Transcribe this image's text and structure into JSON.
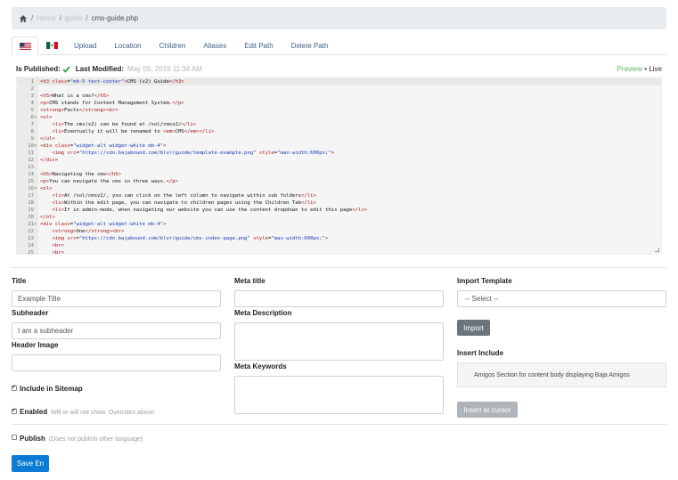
{
  "breadcrumb": {
    "home_icon": "home-icon",
    "items": [
      "Home",
      "guide"
    ],
    "current": "cms-guide.php"
  },
  "tabs": {
    "flags": [
      {
        "icon": "us-flag-icon"
      },
      {
        "icon": "mx-flag-icon"
      }
    ],
    "items": [
      "Upload",
      "Location",
      "Children",
      "Aliases",
      "Edit Path",
      "Delete Path"
    ]
  },
  "status": {
    "published_label": "Is Published:",
    "modified_label": "Last Modified:",
    "modified_value": "May 09, 2019 11:34 AM",
    "preview": "Preview",
    "bullet": "•",
    "live": "Live"
  },
  "editor": {
    "lines": [
      {
        "n": "1",
        "fold": false,
        "html": "<span class=\"tag\">&lt;h3</span> <span class=\"attr\">class</span>=<span class=\"val\">\"mb-5 text-center\"</span><span class=\"tag\">&gt;</span>CMS (v2) Guide<span class=\"tag\">&lt;/h3&gt;</span>"
      },
      {
        "n": "2",
        "fold": false,
        "html": ""
      },
      {
        "n": "3",
        "fold": false,
        "html": "<span class=\"tag\">&lt;h5&gt;</span>What is a cms?<span class=\"tag\">&lt;/h5&gt;</span>"
      },
      {
        "n": "4",
        "fold": false,
        "html": "<span class=\"tag\">&lt;p&gt;</span>CMS stands for Content Management System.<span class=\"tag\">&lt;/p&gt;</span>"
      },
      {
        "n": "5",
        "fold": false,
        "html": "<span class=\"tag\">&lt;strong&gt;</span>Facts<span class=\"tag\">&lt;/strong&gt;&lt;br&gt;</span>"
      },
      {
        "n": "6",
        "fold": true,
        "html": "<span class=\"tag\">&lt;ul&gt;</span>"
      },
      {
        "n": "7",
        "fold": false,
        "html": "    <span class=\"tag\">&lt;li&gt;</span>The cms(v2) can be found at /sol/cmsv2/<span class=\"tag\">&lt;/li&gt;</span>"
      },
      {
        "n": "8",
        "fold": false,
        "html": "    <span class=\"tag\">&lt;li&gt;</span>Eventually it will be renamed to <span class=\"tag\">&lt;em&gt;</span>CMS<span class=\"tag\">&lt;/em&gt;&lt;/li&gt;</span>"
      },
      {
        "n": "9",
        "fold": false,
        "html": "<span class=\"tag\">&lt;/ul&gt;</span>"
      },
      {
        "n": "10",
        "fold": true,
        "html": "<span class=\"tag\">&lt;div</span> <span class=\"attr\">class</span>=<span class=\"val\">\"widget-alt widget-white mb-4\"</span><span class=\"tag\">&gt;</span>"
      },
      {
        "n": "11",
        "fold": false,
        "html": "    <span class=\"tag\">&lt;img</span> <span class=\"attr\">src</span>=<span class=\"val\">\"https://cdn.bajabound.com/blvr/guide/template-example.png\"</span> <span class=\"attr\">style</span>=<span class=\"val\">\"max-width:600px;\"</span><span class=\"tag\">&gt;</span>"
      },
      {
        "n": "12",
        "fold": false,
        "html": "<span class=\"tag\">&lt;/div&gt;</span>"
      },
      {
        "n": "13",
        "fold": false,
        "html": ""
      },
      {
        "n": "14",
        "fold": false,
        "html": "<span class=\"tag\">&lt;h5&gt;</span>Navigating the cms<span class=\"tag\">&lt;/h5&gt;</span>"
      },
      {
        "n": "15",
        "fold": false,
        "html": "<span class=\"tag\">&lt;p&gt;</span>You can navigate the cms in three ways.<span class=\"tag\">&lt;/p&gt;</span>"
      },
      {
        "n": "16",
        "fold": true,
        "html": "<span class=\"tag\">&lt;ol&gt;</span>"
      },
      {
        "n": "17",
        "fold": false,
        "html": "    <span class=\"tag\">&lt;li&gt;</span>At /sol/cmsv2/, you can click on the left column to navigate within sub folders<span class=\"tag\">&lt;/li&gt;</span>"
      },
      {
        "n": "18",
        "fold": false,
        "html": "    <span class=\"tag\">&lt;li&gt;</span>Within the edit page, you can navigate to children pages using the Children Tab<span class=\"tag\">&lt;/li&gt;</span>"
      },
      {
        "n": "19",
        "fold": false,
        "html": "    <span class=\"tag\">&lt;li&gt;</span>If in admin-mode, when navigating our website you can use the content dropdown to edit this page<span class=\"tag\">&lt;/li&gt;</span>"
      },
      {
        "n": "20",
        "fold": false,
        "html": "<span class=\"tag\">&lt;/ol&gt;</span>"
      },
      {
        "n": "21",
        "fold": true,
        "html": "<span class=\"tag\">&lt;div</span> <span class=\"attr\">class</span>=<span class=\"val\">\"widget-alt widget-white mb-4\"</span><span class=\"tag\">&gt;</span>"
      },
      {
        "n": "22",
        "fold": false,
        "html": "    <span class=\"tag\">&lt;strong&gt;</span>One<span class=\"tag\">&lt;/strong&gt;&lt;br&gt;</span>"
      },
      {
        "n": "23",
        "fold": false,
        "html": "    <span class=\"tag\">&lt;img</span> <span class=\"attr\">src</span>=<span class=\"val\">\"https://cdn.bajabound.com/blvr/guide/cms-index-page.png\"</span> <span class=\"attr\">style</span>=<span class=\"val\">\"max-width:600px;\"</span><span class=\"tag\">&gt;</span>"
      },
      {
        "n": "24",
        "fold": false,
        "html": "    <span class=\"tag\">&lt;br&gt;</span>"
      },
      {
        "n": "25",
        "fold": false,
        "html": "    <span class=\"tag\">&lt;br&gt;</span>"
      }
    ]
  },
  "form": {
    "title_label": "Title",
    "title_placeholder": "Example Title",
    "subheader_label": "Subheader",
    "subheader_placeholder": "I am a subheader",
    "header_image_label": "Header Image",
    "meta_title_label": "Meta title",
    "meta_description_label": "Meta Description",
    "meta_keywords_label": "Meta Keywords",
    "import_template_label": "Import Template",
    "import_select_value": "-- Select --",
    "import_button": "Import",
    "insert_include_label": "Insert Include",
    "insert_include_text": "Amigos Section for content body displaying Baja Amigos",
    "insert_button": "Insert at cursor",
    "sitemap_label": "Include in Sitemap",
    "sitemap_checked": true,
    "enabled_label": "Enabled",
    "enabled_hint": "Will or will not show. Overrides above.",
    "enabled_checked": true,
    "publish_label": "Publish",
    "publish_hint": "(Does not publish other language)",
    "publish_checked": false,
    "save_button": "Save En"
  },
  "colors": {
    "accent": "#0d7ad6",
    "success": "#5cb85c",
    "secondary": "#6c757d",
    "link": "#3a5f86"
  }
}
